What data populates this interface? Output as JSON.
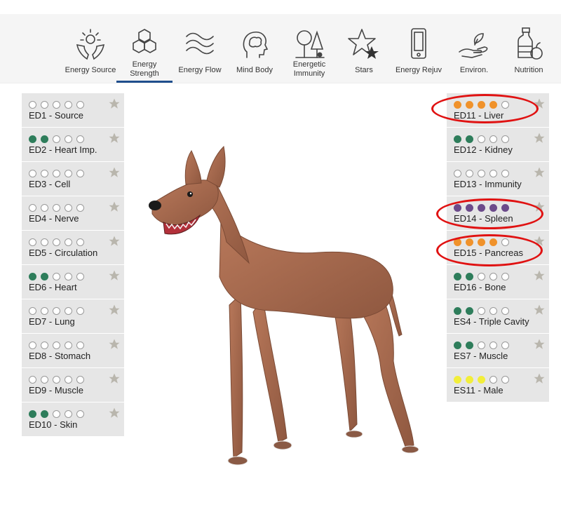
{
  "nav": {
    "items": [
      {
        "label": "Energy Source",
        "icon": "hands-sun-icon"
      },
      {
        "label": "Energy Strength",
        "icon": "hexagons-icon",
        "active": true
      },
      {
        "label": "Energy Flow",
        "icon": "waves-icon"
      },
      {
        "label": "Mind Body",
        "icon": "head-brain-icon"
      },
      {
        "label": "Energetic Immunity",
        "icon": "trees-icon"
      },
      {
        "label": "Stars",
        "icon": "stars-icon"
      },
      {
        "label": "Energy Rejuv",
        "icon": "phone-icon"
      },
      {
        "label": "Environ.",
        "icon": "hand-leaf-icon"
      },
      {
        "label": "Nutrition",
        "icon": "bottle-fruit-icon"
      }
    ]
  },
  "left_panel": {
    "rows": [
      {
        "label": "ED1 - Source",
        "filled": 0,
        "color": "#ffffff"
      },
      {
        "label": "ED2 - Heart Imp.",
        "filled": 2,
        "color": "#2e7d5b"
      },
      {
        "label": "ED3 - Cell",
        "filled": 0,
        "color": "#ffffff"
      },
      {
        "label": "ED4 - Nerve",
        "filled": 0,
        "color": "#ffffff"
      },
      {
        "label": "ED5 - Circulation",
        "filled": 0,
        "color": "#ffffff"
      },
      {
        "label": "ED6 - Heart",
        "filled": 2,
        "color": "#2e7d5b"
      },
      {
        "label": "ED7 - Lung",
        "filled": 0,
        "color": "#ffffff"
      },
      {
        "label": "ED8 - Stomach",
        "filled": 0,
        "color": "#ffffff"
      },
      {
        "label": "ED9 - Muscle",
        "filled": 0,
        "color": "#ffffff"
      },
      {
        "label": "ED10 - Skin",
        "filled": 2,
        "color": "#2e7d5b"
      }
    ]
  },
  "right_panel": {
    "rows": [
      {
        "label": "ED11 - Liver",
        "filled": 4,
        "color": "#f0922b"
      },
      {
        "label": "ED12 - Kidney",
        "filled": 2,
        "color": "#2e7d5b"
      },
      {
        "label": "ED13 - Immunity",
        "filled": 0,
        "color": "#ffffff"
      },
      {
        "label": "ED14 - Spleen",
        "filled": 5,
        "color": "#6b4a8a"
      },
      {
        "label": "ED15 - Pancreas",
        "filled": 4,
        "color": "#f0922b"
      },
      {
        "label": "ED16 - Bone",
        "filled": 2,
        "color": "#2e7d5b"
      },
      {
        "label": "ES4 - Triple Cavity",
        "filled": 2,
        "color": "#2e7d5b"
      },
      {
        "label": "ES7 - Muscle",
        "filled": 2,
        "color": "#2e7d5b"
      },
      {
        "label": "ES11 - Male",
        "filled": 3,
        "color": "#f2ee3a"
      }
    ]
  },
  "colors": {
    "accent_underline": "#1f4e8c",
    "highlight_ring": "#e01212",
    "dog_body": "#a8694c"
  }
}
